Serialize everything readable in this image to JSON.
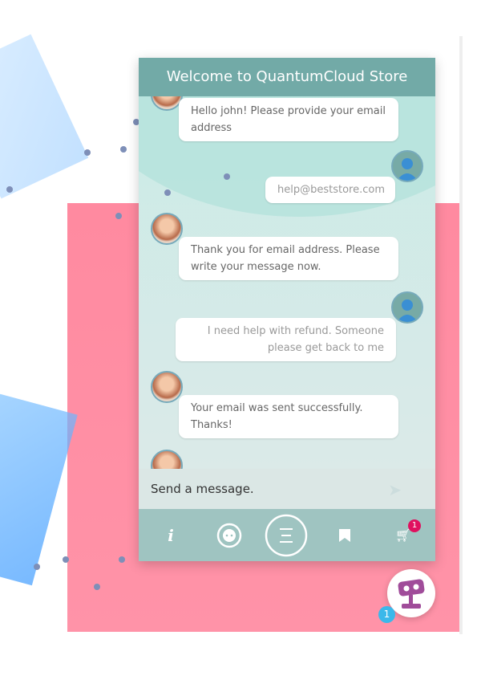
{
  "header": {
    "title": "Welcome to QuantumCloud Store"
  },
  "messages": [
    {
      "from": "bot",
      "text": "Hello john! Please provide your email address"
    },
    {
      "from": "user",
      "text": "help@beststore.com"
    },
    {
      "from": "bot",
      "text": "Thank you for email address. Please write your message now."
    },
    {
      "from": "user",
      "text": "I need help with refund. Someone please get back to me"
    },
    {
      "from": "bot",
      "text": "Your email was sent successfully. Thanks!"
    }
  ],
  "input": {
    "placeholder": "Send a message."
  },
  "nav": {
    "info": "i",
    "cart_badge": "1",
    "icons": [
      "info-icon",
      "support-agent-icon",
      "menu-icon",
      "bookmark-icon",
      "cart-icon"
    ]
  },
  "launcher": {
    "badge": "1"
  },
  "colors": {
    "header": "#72aaa7",
    "bar": "#9fc4c1",
    "background": "#ff8aa0",
    "cart_badge": "#e0115f",
    "launcher_badge": "#3bb8ea"
  }
}
